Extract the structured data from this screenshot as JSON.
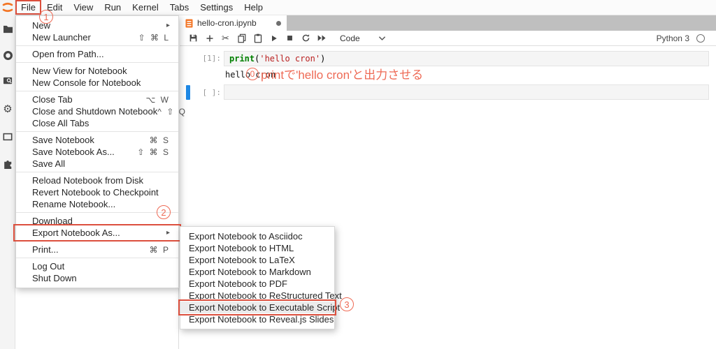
{
  "colors": {
    "annotation_red": "#dc4f3d",
    "annotation_salmon": "#ee6a55",
    "jupyter_orange": "#f37626",
    "active_cell_blue": "#1e88e5",
    "code_keyword_green": "#008000",
    "code_string_red": "#ba2121"
  },
  "icons": {
    "submenu_arrow": "▸",
    "cut_glyph": "✂",
    "gear_glyph": "⚙"
  },
  "menubar": {
    "items": [
      "File",
      "Edit",
      "View",
      "Run",
      "Kernel",
      "Tabs",
      "Settings",
      "Help"
    ]
  },
  "sidebar": {
    "icons": [
      "jupyter-logo",
      "file-browser",
      "running-sessions",
      "command-palette",
      "property-inspector",
      "open-tabs",
      "extension-manager"
    ]
  },
  "file_menu": {
    "items": [
      {
        "label": "New"
      },
      {
        "label": "New Launcher",
        "shortcut": "⇧ ⌘ L"
      },
      {
        "label": "Open from Path..."
      },
      {
        "label": "New View for Notebook"
      },
      {
        "label": "New Console for Notebook"
      },
      {
        "label": "Close Tab",
        "shortcut": "⌥ W"
      },
      {
        "label": "Close and Shutdown Notebook",
        "shortcut": "^ ⇧ Q"
      },
      {
        "label": "Close All Tabs"
      },
      {
        "label": "Save Notebook",
        "shortcut": "⌘ S"
      },
      {
        "label": "Save Notebook As...",
        "shortcut": "⇧ ⌘ S"
      },
      {
        "label": "Save All"
      },
      {
        "label": "Reload Notebook from Disk"
      },
      {
        "label": "Revert Notebook to Checkpoint"
      },
      {
        "label": "Rename Notebook..."
      },
      {
        "label": "Download"
      },
      {
        "label": "Export Notebook As..."
      },
      {
        "label": "Print...",
        "shortcut": "⌘ P"
      },
      {
        "label": "Log Out"
      },
      {
        "label": "Shut Down"
      }
    ]
  },
  "export_submenu": {
    "items": [
      {
        "label": "Export Notebook to Asciidoc"
      },
      {
        "label": "Export Notebook to HTML"
      },
      {
        "label": "Export Notebook to LaTeX"
      },
      {
        "label": "Export Notebook to Markdown"
      },
      {
        "label": "Export Notebook to PDF"
      },
      {
        "label": "Export Notebook to ReStructured Text"
      },
      {
        "label": "Export Notebook to Executable Script"
      },
      {
        "label": "Export Notebook to Reveal.js Slides"
      }
    ]
  },
  "notebook": {
    "tab_title": "hello-cron.ipynb",
    "cell_type": "Code",
    "kernel": "Python 3"
  },
  "cells": {
    "cell1": {
      "prompt": "[1]:",
      "code_fn": "print",
      "code_open": "(",
      "code_str": "'hello cron'",
      "code_close": ")",
      "output": "hello cron"
    },
    "cell2": {
      "prompt": "[ ]:"
    }
  },
  "annotations": {
    "step0": {
      "num": "0",
      "text": "printで'hello cron'と出力させる"
    },
    "step1": "1",
    "step2": "2",
    "step3": "3"
  }
}
